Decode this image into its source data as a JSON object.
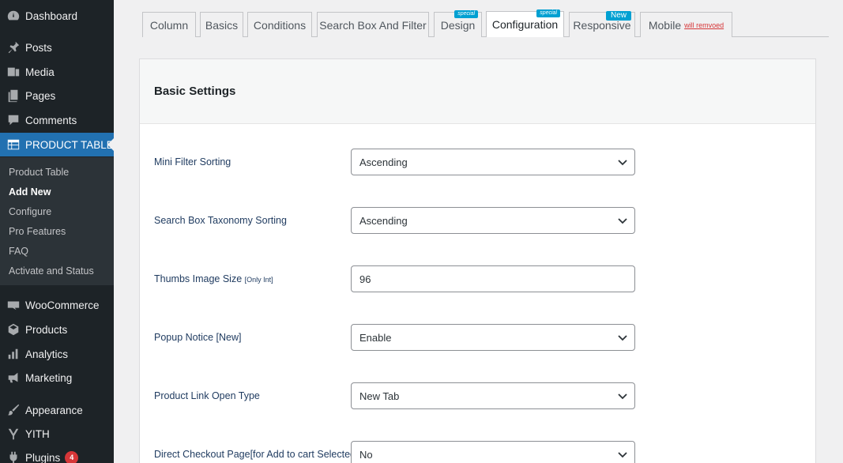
{
  "sidebar": {
    "items": [
      {
        "label": "Dashboard",
        "icon": "dashboard-icon"
      },
      {
        "label": "Posts",
        "icon": "pin-icon"
      },
      {
        "label": "Media",
        "icon": "media-icon"
      },
      {
        "label": "Pages",
        "icon": "pages-icon"
      },
      {
        "label": "Comments",
        "icon": "comment-icon"
      },
      {
        "label": "PRODUCT TABLE",
        "icon": "table-icon",
        "active": true
      },
      {
        "label": "WooCommerce",
        "icon": "woo-icon"
      },
      {
        "label": "Products",
        "icon": "products-icon"
      },
      {
        "label": "Analytics",
        "icon": "analytics-icon"
      },
      {
        "label": "Marketing",
        "icon": "megaphone-icon"
      },
      {
        "label": "Appearance",
        "icon": "brush-icon"
      },
      {
        "label": "YITH",
        "icon": "yith-icon"
      },
      {
        "label": "Plugins",
        "icon": "plugin-icon",
        "badge": "4"
      }
    ],
    "submenu": [
      {
        "label": "Product Table"
      },
      {
        "label": "Add New",
        "current": true
      },
      {
        "label": "Configure"
      },
      {
        "label": "Pro Features"
      },
      {
        "label": "FAQ"
      },
      {
        "label": "Activate and Status"
      }
    ]
  },
  "tabs": [
    {
      "label": "Column"
    },
    {
      "label": "Basics"
    },
    {
      "label": "Conditions"
    },
    {
      "label": "Search Box And Filter"
    },
    {
      "label": "Design",
      "flag": "special"
    },
    {
      "label": "Configuration",
      "flag": "special",
      "active": true
    },
    {
      "label": "Responsive",
      "flag": "New"
    },
    {
      "label": "Mobile",
      "note": "will remvoed"
    }
  ],
  "panel": {
    "title": "Basic Settings",
    "rows": [
      {
        "label": "Mini Filter Sorting",
        "value": "Ascending",
        "type": "select"
      },
      {
        "label": "Search Box Taxonomy Sorting",
        "value": "Ascending",
        "type": "select"
      },
      {
        "label": "Thumbs Image Size",
        "hint": "[Only Int]",
        "value": "96",
        "type": "input"
      },
      {
        "label": "Popup Notice [New]",
        "value": "Enable",
        "type": "select"
      },
      {
        "label": "Product Link Open Type",
        "value": "New Tab",
        "type": "select"
      },
      {
        "label": "Direct Checkout Page[for Add to cart Selected]",
        "value": "No",
        "type": "select"
      }
    ]
  },
  "colors": {
    "sidebar_bg": "#1d2327",
    "active_menu": "#2271b1",
    "flag": "#00a0d2",
    "removed_note": "#d63638"
  }
}
